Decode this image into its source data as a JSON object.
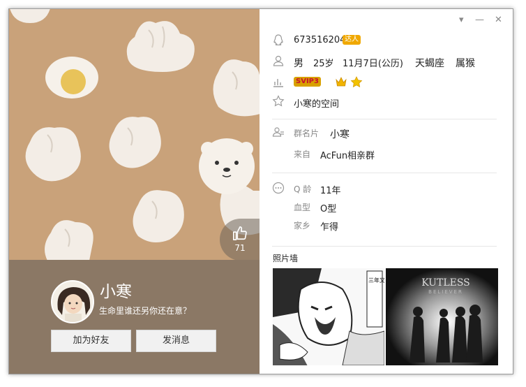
{
  "left": {
    "like": {
      "count": "71",
      "icon": "thumbs-up-icon"
    },
    "profile": {
      "nickname": "小寒",
      "signature": "生命里谁还另你还在意？"
    },
    "buttons": {
      "add_friend": "加为好友",
      "send_message": "发消息"
    }
  },
  "window_controls": {
    "dropdown": "▾",
    "minimize": "—",
    "close": "✕"
  },
  "info": {
    "qq": "673516204",
    "qq_badge": "达人",
    "gender": "男",
    "age": "25岁",
    "birthday": "11月7日(公历)",
    "zodiac": "天蝎座",
    "chinese_zodiac": "属猴",
    "vip_badge": "SVIP3",
    "space": "小寒的空间",
    "group_card_label": "群名片",
    "group_card_value": "小寒",
    "from_label": "来自",
    "from_value": "AcFun相亲群",
    "q_age_label": "Q 龄",
    "q_age_value": "11年",
    "blood_label": "血型",
    "blood_value": "O型",
    "hometown_label": "家乡",
    "hometown_value": "乍得"
  },
  "photos": {
    "title": "照片墙",
    "items": [
      {
        "text": "三年又三年再三年的容颜 历史有谁意蚂"
      },
      {
        "title": "KUTLESS",
        "subtitle": "BELIEVER"
      }
    ]
  },
  "colors": {
    "cover_bg": "#c9a27a",
    "profile_bg": "#8b7865",
    "vip_gold": "#f0a800"
  }
}
